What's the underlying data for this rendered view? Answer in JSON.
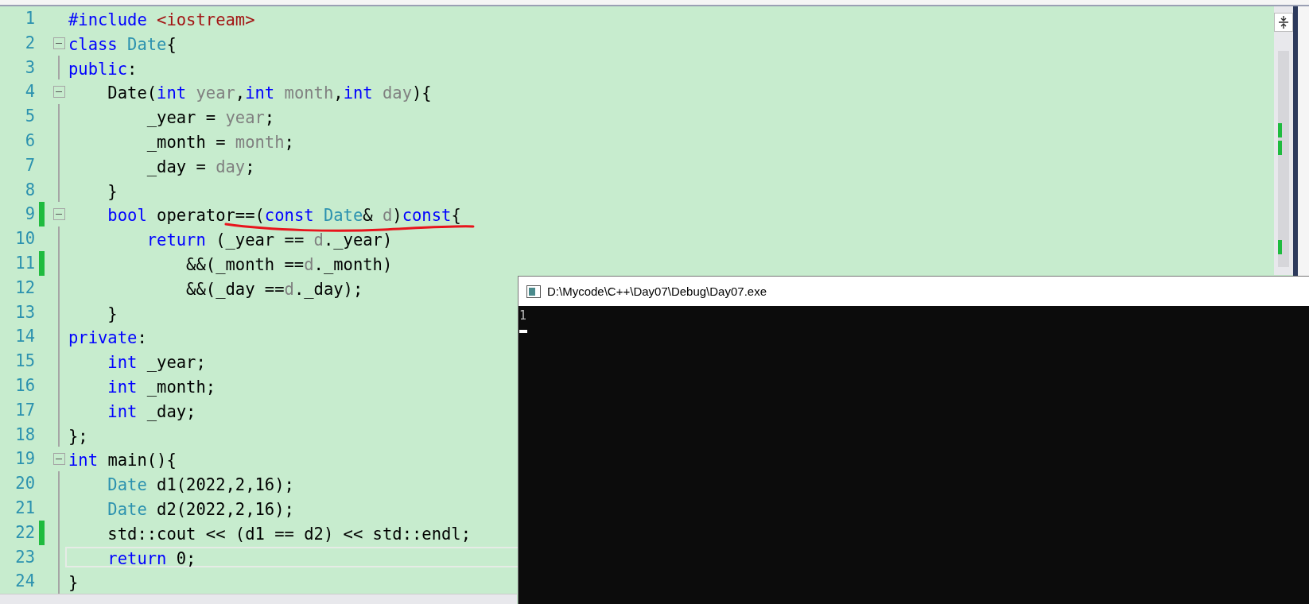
{
  "editor": {
    "lines": [
      {
        "number": "1",
        "collapsible": false,
        "changed": false,
        "current": false,
        "tokens": [
          {
            "text": "#include ",
            "kind": "keyword"
          },
          {
            "text": "<iostream>",
            "kind": "string"
          }
        ]
      },
      {
        "number": "2",
        "collapsible": true,
        "changed": false,
        "current": false,
        "tokens": [
          {
            "text": "class ",
            "kind": "keyword"
          },
          {
            "text": "Date",
            "kind": "type"
          },
          {
            "text": "{",
            "kind": "plain"
          }
        ]
      },
      {
        "number": "3",
        "collapsible": false,
        "changed": false,
        "current": false,
        "tokens": [
          {
            "text": "public",
            "kind": "keyword"
          },
          {
            "text": ":",
            "kind": "plain"
          }
        ]
      },
      {
        "number": "4",
        "collapsible": true,
        "changed": false,
        "current": false,
        "tokens": [
          {
            "text": "    Date(",
            "kind": "plain"
          },
          {
            "text": "int ",
            "kind": "keyword"
          },
          {
            "text": "year",
            "kind": "param"
          },
          {
            "text": ",",
            "kind": "plain"
          },
          {
            "text": "int ",
            "kind": "keyword"
          },
          {
            "text": "month",
            "kind": "param"
          },
          {
            "text": ",",
            "kind": "plain"
          },
          {
            "text": "int ",
            "kind": "keyword"
          },
          {
            "text": "day",
            "kind": "param"
          },
          {
            "text": "){",
            "kind": "plain"
          }
        ]
      },
      {
        "number": "5",
        "collapsible": false,
        "changed": false,
        "current": false,
        "tokens": [
          {
            "text": "        _year = ",
            "kind": "plain"
          },
          {
            "text": "year",
            "kind": "param"
          },
          {
            "text": ";",
            "kind": "plain"
          }
        ]
      },
      {
        "number": "6",
        "collapsible": false,
        "changed": false,
        "current": false,
        "tokens": [
          {
            "text": "        _month = ",
            "kind": "plain"
          },
          {
            "text": "month",
            "kind": "param"
          },
          {
            "text": ";",
            "kind": "plain"
          }
        ]
      },
      {
        "number": "7",
        "collapsible": false,
        "changed": false,
        "current": false,
        "tokens": [
          {
            "text": "        _day = ",
            "kind": "plain"
          },
          {
            "text": "day",
            "kind": "param"
          },
          {
            "text": ";",
            "kind": "plain"
          }
        ]
      },
      {
        "number": "8",
        "collapsible": false,
        "changed": false,
        "current": false,
        "tokens": [
          {
            "text": "    }",
            "kind": "plain"
          }
        ]
      },
      {
        "number": "9",
        "collapsible": true,
        "changed": true,
        "current": false,
        "tokens": [
          {
            "text": "    bool ",
            "kind": "keyword"
          },
          {
            "text": "operator==(",
            "kind": "plain"
          },
          {
            "text": "const ",
            "kind": "keyword"
          },
          {
            "text": "Date",
            "kind": "type"
          },
          {
            "text": "& ",
            "kind": "plain"
          },
          {
            "text": "d",
            "kind": "param"
          },
          {
            "text": ")",
            "kind": "plain"
          },
          {
            "text": "const",
            "kind": "keyword"
          },
          {
            "text": "{",
            "kind": "plain"
          }
        ]
      },
      {
        "number": "10",
        "collapsible": false,
        "changed": false,
        "current": false,
        "tokens": [
          {
            "text": "        return ",
            "kind": "keyword"
          },
          {
            "text": "(_year == ",
            "kind": "plain"
          },
          {
            "text": "d",
            "kind": "param"
          },
          {
            "text": "._year)",
            "kind": "plain"
          }
        ]
      },
      {
        "number": "11",
        "collapsible": false,
        "changed": true,
        "current": false,
        "tokens": [
          {
            "text": "            &&(_month ==",
            "kind": "plain"
          },
          {
            "text": "d",
            "kind": "param"
          },
          {
            "text": "._month)",
            "kind": "plain"
          }
        ]
      },
      {
        "number": "12",
        "collapsible": false,
        "changed": false,
        "current": false,
        "tokens": [
          {
            "text": "            &&(_day ==",
            "kind": "plain"
          },
          {
            "text": "d",
            "kind": "param"
          },
          {
            "text": "._day);",
            "kind": "plain"
          }
        ]
      },
      {
        "number": "13",
        "collapsible": false,
        "changed": false,
        "current": false,
        "tokens": [
          {
            "text": "    }",
            "kind": "plain"
          }
        ]
      },
      {
        "number": "14",
        "collapsible": false,
        "changed": false,
        "current": false,
        "tokens": [
          {
            "text": "private",
            "kind": "keyword"
          },
          {
            "text": ":",
            "kind": "plain"
          }
        ]
      },
      {
        "number": "15",
        "collapsible": false,
        "changed": false,
        "current": false,
        "tokens": [
          {
            "text": "    int ",
            "kind": "keyword"
          },
          {
            "text": "_year;",
            "kind": "plain"
          }
        ]
      },
      {
        "number": "16",
        "collapsible": false,
        "changed": false,
        "current": false,
        "tokens": [
          {
            "text": "    int ",
            "kind": "keyword"
          },
          {
            "text": "_month;",
            "kind": "plain"
          }
        ]
      },
      {
        "number": "17",
        "collapsible": false,
        "changed": false,
        "current": false,
        "tokens": [
          {
            "text": "    int ",
            "kind": "keyword"
          },
          {
            "text": "_day;",
            "kind": "plain"
          }
        ]
      },
      {
        "number": "18",
        "collapsible": false,
        "changed": false,
        "current": false,
        "tokens": [
          {
            "text": "};",
            "kind": "plain"
          }
        ]
      },
      {
        "number": "19",
        "collapsible": true,
        "changed": false,
        "current": false,
        "tokens": [
          {
            "text": "int ",
            "kind": "keyword"
          },
          {
            "text": "main(){",
            "kind": "plain"
          }
        ]
      },
      {
        "number": "20",
        "collapsible": false,
        "changed": false,
        "current": false,
        "tokens": [
          {
            "text": "    Date ",
            "kind": "type"
          },
          {
            "text": "d1(2022,2,16);",
            "kind": "plain"
          }
        ]
      },
      {
        "number": "21",
        "collapsible": false,
        "changed": false,
        "current": false,
        "tokens": [
          {
            "text": "    Date ",
            "kind": "type"
          },
          {
            "text": "d2(2022,2,16);",
            "kind": "plain"
          }
        ]
      },
      {
        "number": "22",
        "collapsible": false,
        "changed": true,
        "current": false,
        "tokens": [
          {
            "text": "    std::cout << (d1 == d2) << std::endl;",
            "kind": "plain"
          }
        ]
      },
      {
        "number": "23",
        "collapsible": false,
        "changed": false,
        "current": true,
        "tokens": [
          {
            "text": "    return ",
            "kind": "keyword"
          },
          {
            "text": "0;",
            "kind": "plain"
          }
        ]
      },
      {
        "number": "24",
        "collapsible": false,
        "changed": false,
        "current": false,
        "tokens": [
          {
            "text": "}",
            "kind": "plain"
          }
        ]
      }
    ]
  },
  "console": {
    "title": "D:\\Mycode\\C++\\Day07\\Debug\\Day07.exe",
    "output": "1"
  }
}
